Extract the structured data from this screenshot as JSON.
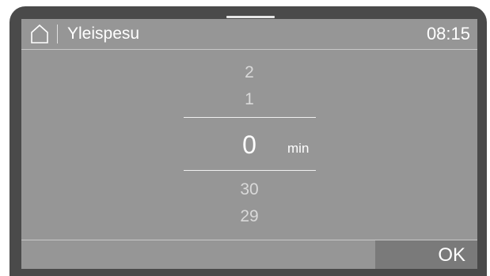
{
  "header": {
    "icon": "home-icon",
    "title": "Yleispesu",
    "time": "08:15"
  },
  "picker": {
    "above": [
      "2",
      "1"
    ],
    "selected": "0",
    "unit": "min",
    "below": [
      "30",
      "29"
    ]
  },
  "footer": {
    "ok_label": "OK"
  },
  "colors": {
    "screen_bg": "#969696",
    "bezel": "#4a4a4a",
    "ok_button_bg": "#7a7a7a",
    "text_primary": "#ffffff",
    "text_dim": "#d9d9d9"
  }
}
